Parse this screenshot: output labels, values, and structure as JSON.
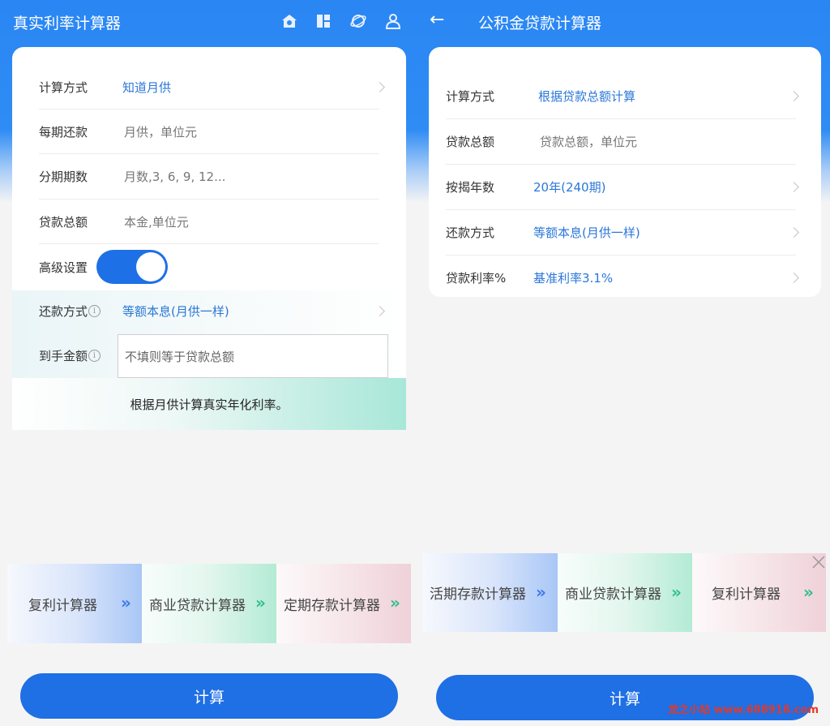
{
  "left": {
    "title": "真实利率计算器",
    "header_icons": [
      "home-icon",
      "grid-icon",
      "planet-icon",
      "user-icon"
    ],
    "rows": [
      {
        "label": "计算方式",
        "value": "知道月供"
      },
      {
        "label": "每期还款",
        "value": "月供，单位元"
      },
      {
        "label": "分期期数",
        "value": "月数,3, 6, 9, 12..."
      },
      {
        "label": "贷款总额",
        "value": "本金,单位元"
      }
    ],
    "advanced_label": "高级设置",
    "advanced_on": true,
    "repay_label": "还款方式",
    "repay_value": "等额本息(月供一样)",
    "received_label": "到手金额",
    "received_placeholder": "不填则等于贷款总额",
    "info_glyph": "i",
    "banner_text": "根据月供计算真实年化利率。",
    "tiles": [
      "复利计算器",
      "商业贷款计算器",
      "定期存款计算器"
    ],
    "arrow_glyph": "»",
    "calc_label": "计算"
  },
  "right": {
    "title": "公积金贷款计算器",
    "back_glyph": "←",
    "rows": [
      {
        "label": "计算方式",
        "value": "根据贷款总额计算"
      },
      {
        "label": "贷款总额",
        "value": "贷款总额，单位元"
      },
      {
        "label": "按揭年数",
        "value": "20年(240期)"
      },
      {
        "label": "还款方式",
        "value": "等额本息(月供一样)"
      },
      {
        "label": "贷款利率%",
        "value": "基准利率3.1%"
      }
    ],
    "tiles": [
      "活期存款计算器",
      "商业贷款计算器",
      "复利计算器"
    ],
    "arrow_glyph": "»",
    "calc_label": "计算"
  },
  "watermark": "龙之小站 www.688918.com",
  "colors": {
    "primary": "#1f6fe5",
    "header": "#2f8cf4",
    "link": "#2b77d8"
  }
}
